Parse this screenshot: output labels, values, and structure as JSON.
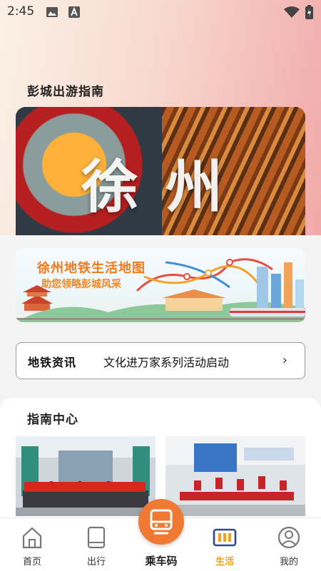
{
  "status_bar": {
    "time": "2:45"
  },
  "travel_guide": {
    "title_plain": "彭城出游",
    "title_highlight": "指南",
    "hero_calligraphy": [
      "徐",
      "州"
    ]
  },
  "banner": {
    "title": "徐州地铁生活地图",
    "subtitle": "助您领略彭城风采"
  },
  "notice": {
    "label": "地铁资讯",
    "text": "文化进万家系列活动启动",
    "arrow": "›"
  },
  "guide_center": {
    "title_plain": "指南",
    "title_highlight": "中心"
  },
  "tabbar": {
    "items": [
      {
        "label": "首页",
        "icon": "home-icon",
        "active": false
      },
      {
        "label": "出行",
        "icon": "tablet-icon",
        "active": false
      },
      {
        "label": "乘车码",
        "icon": "train-qr-icon",
        "active": false
      },
      {
        "label": "生活",
        "icon": "life-icon",
        "active": true
      },
      {
        "label": "我的",
        "icon": "profile-icon",
        "active": false
      }
    ]
  },
  "colors": {
    "accent_orange": "#f07a33",
    "active_tab": "#f2a018",
    "highlight_red": "#e1283c"
  }
}
